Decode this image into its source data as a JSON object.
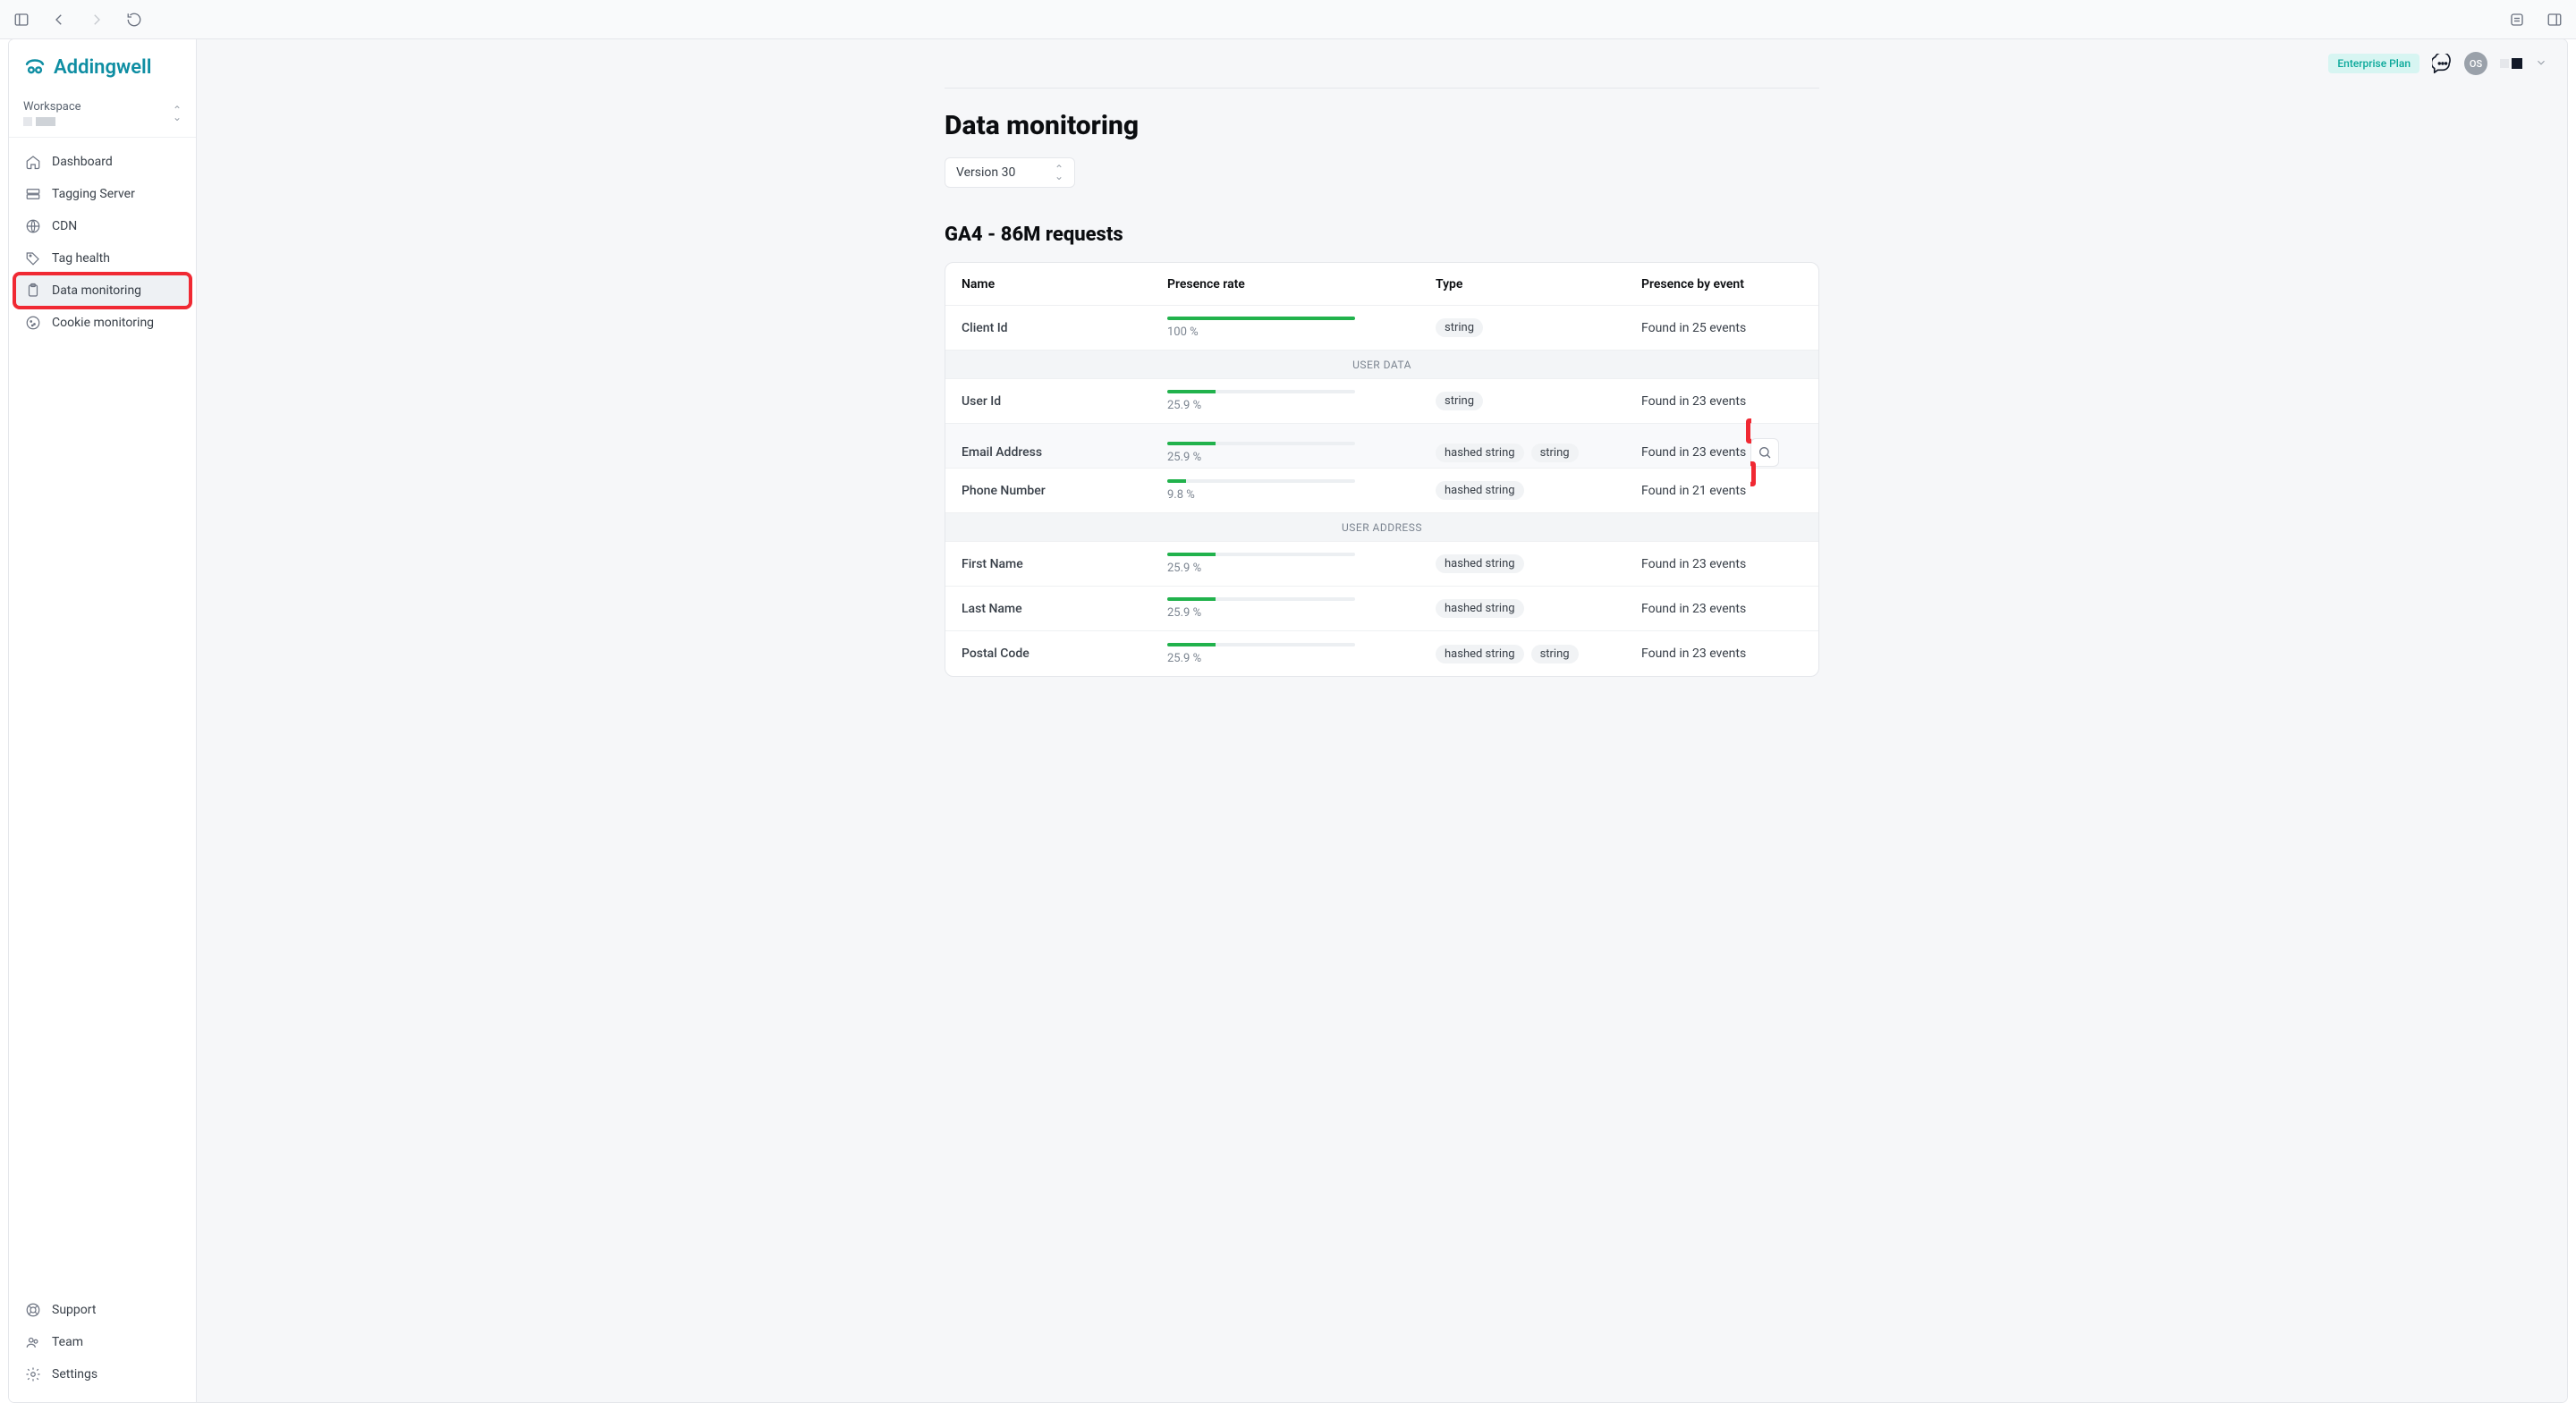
{
  "brand": "Addingwell",
  "sidebar": {
    "workspace_label": "Workspace",
    "nav": [
      {
        "label": "Dashboard"
      },
      {
        "label": "Tagging Server"
      },
      {
        "label": "CDN"
      },
      {
        "label": "Tag health"
      },
      {
        "label": "Data monitoring"
      },
      {
        "label": "Cookie monitoring"
      }
    ],
    "bottom": [
      {
        "label": "Support"
      },
      {
        "label": "Team"
      },
      {
        "label": "Settings"
      }
    ]
  },
  "topbar": {
    "plan_badge": "Enterprise Plan",
    "avatar_initials": "OS"
  },
  "page": {
    "title": "Data monitoring",
    "version_label": "Version 30",
    "section_title": "GA4 - 86M requests",
    "columns": {
      "name": "Name",
      "presence": "Presence rate",
      "type": "Type",
      "events": "Presence by event"
    },
    "sections": {
      "user_data": "USER DATA",
      "user_address": "USER ADDRESS"
    },
    "rows": {
      "client_id": {
        "name": "Client Id",
        "pct": "100 %",
        "bar": 100,
        "types": [
          "string"
        ],
        "events": "Found in 25 events"
      },
      "user_id": {
        "name": "User Id",
        "pct": "25.9 %",
        "bar": 25.9,
        "types": [
          "string"
        ],
        "events": "Found in 23 events"
      },
      "email": {
        "name": "Email Address",
        "pct": "25.9 %",
        "bar": 25.9,
        "types": [
          "hashed string",
          "string"
        ],
        "events": "Found in 23 events"
      },
      "phone": {
        "name": "Phone Number",
        "pct": "9.8 %",
        "bar": 9.8,
        "types": [
          "hashed string"
        ],
        "events": "Found in 21 events"
      },
      "first_name": {
        "name": "First Name",
        "pct": "25.9 %",
        "bar": 25.9,
        "types": [
          "hashed string"
        ],
        "events": "Found in 23 events"
      },
      "last_name": {
        "name": "Last Name",
        "pct": "25.9 %",
        "bar": 25.9,
        "types": [
          "hashed string"
        ],
        "events": "Found in 23 events"
      },
      "postal_code": {
        "name": "Postal Code",
        "pct": "25.9 %",
        "bar": 25.9,
        "types": [
          "hashed string",
          "string"
        ],
        "events": "Found in 23 events"
      }
    }
  }
}
